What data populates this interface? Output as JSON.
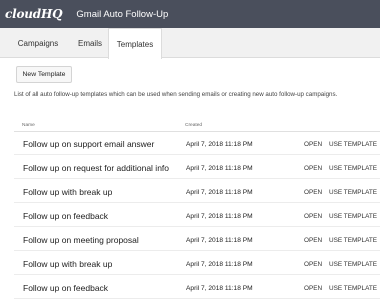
{
  "header": {
    "logo": "cloudHQ",
    "title": "Gmail Auto Follow-Up"
  },
  "tabs": [
    {
      "label": "Campaigns"
    },
    {
      "label": "Emails"
    },
    {
      "label": "Templates"
    }
  ],
  "new_template_button": "New Template",
  "description": "List of all auto follow-up templates which can be used when sending emails or creating new auto follow-up campaigns.",
  "table": {
    "headers": {
      "name": "Name",
      "created": "Created"
    },
    "open_label": "OPEN",
    "use_label": "USE TEMPLATE",
    "rows": [
      {
        "name": "Follow up on support email answer",
        "created": "April 7, 2018 11:18 PM"
      },
      {
        "name": "Follow up on request for additional info",
        "created": "April 7, 2018 11:18 PM"
      },
      {
        "name": "Follow up with break up",
        "created": "April 7, 2018 11:18 PM"
      },
      {
        "name": "Follow up on feedback",
        "created": "April 7, 2018 11:18 PM"
      },
      {
        "name": "Follow up on meeting proposal",
        "created": "April 7, 2018 11:18 PM"
      },
      {
        "name": "Follow up with break up",
        "created": "April 7, 2018 11:18 PM"
      },
      {
        "name": "Follow up on feedback",
        "created": "April 7, 2018 11:18 PM"
      }
    ]
  }
}
